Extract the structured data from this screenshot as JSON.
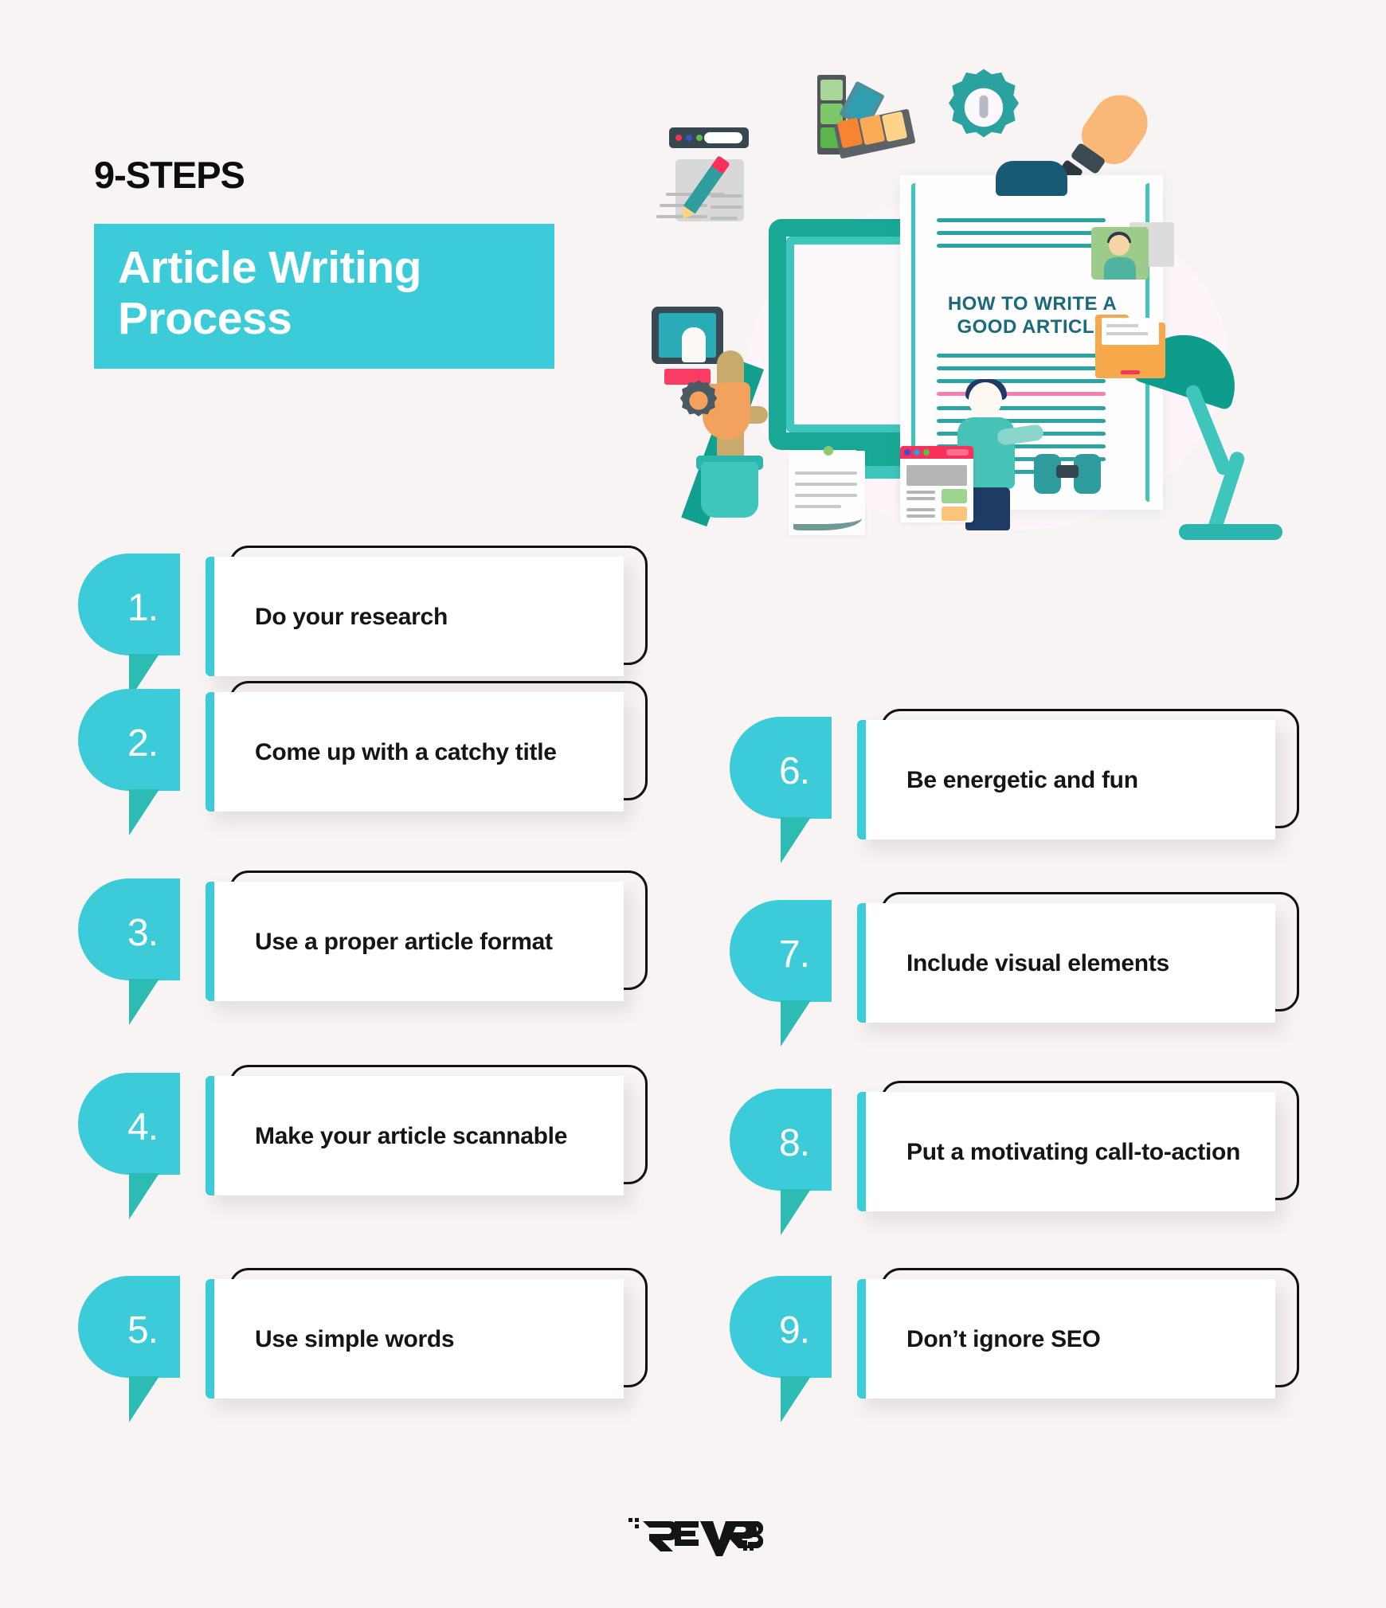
{
  "header": {
    "kicker": "9-STEPS",
    "title_line1": "Article Writing",
    "title_line2": "Process",
    "accent_color": "#3ccbd8",
    "background_color": "#f8f4f4"
  },
  "illustration": {
    "screen_title_line1": "HOW TO WRITE A",
    "screen_title_line2": "GOOD ARTICLE",
    "screen_title_color": "#176b7c",
    "icons": [
      "browser-bar-icon",
      "document-pencil-icon",
      "color-swatch-icon",
      "gear-idea-icon",
      "lightbulb-icon",
      "tablet-touch-icon",
      "cactus-plant-icon",
      "monitor-icon",
      "clipboard-document-icon",
      "desk-lamp-icon",
      "person-writing-icon",
      "brain-gear-icon",
      "note-paper-icon",
      "browser-window-icon",
      "binoculars-icon",
      "avatar-card-icon",
      "folder-icon"
    ]
  },
  "steps_left": [
    {
      "number": "1.",
      "text": "Do your research"
    },
    {
      "number": "2.",
      "text": "Come up with a catchy title"
    },
    {
      "number": "3.",
      "text": "Use a proper article format"
    },
    {
      "number": "4.",
      "text": "Make your article scannable"
    },
    {
      "number": "5.",
      "text": "Use simple words"
    }
  ],
  "steps_right": [
    {
      "number": "6.",
      "text": "Be energetic and fun"
    },
    {
      "number": "7.",
      "text": "Include visual elements"
    },
    {
      "number": "8.",
      "text": "Put a motivating call-to-action"
    },
    {
      "number": "9.",
      "text": "Don’t ignore SEO"
    }
  ],
  "footer": {
    "logo_text": "REVERB"
  }
}
